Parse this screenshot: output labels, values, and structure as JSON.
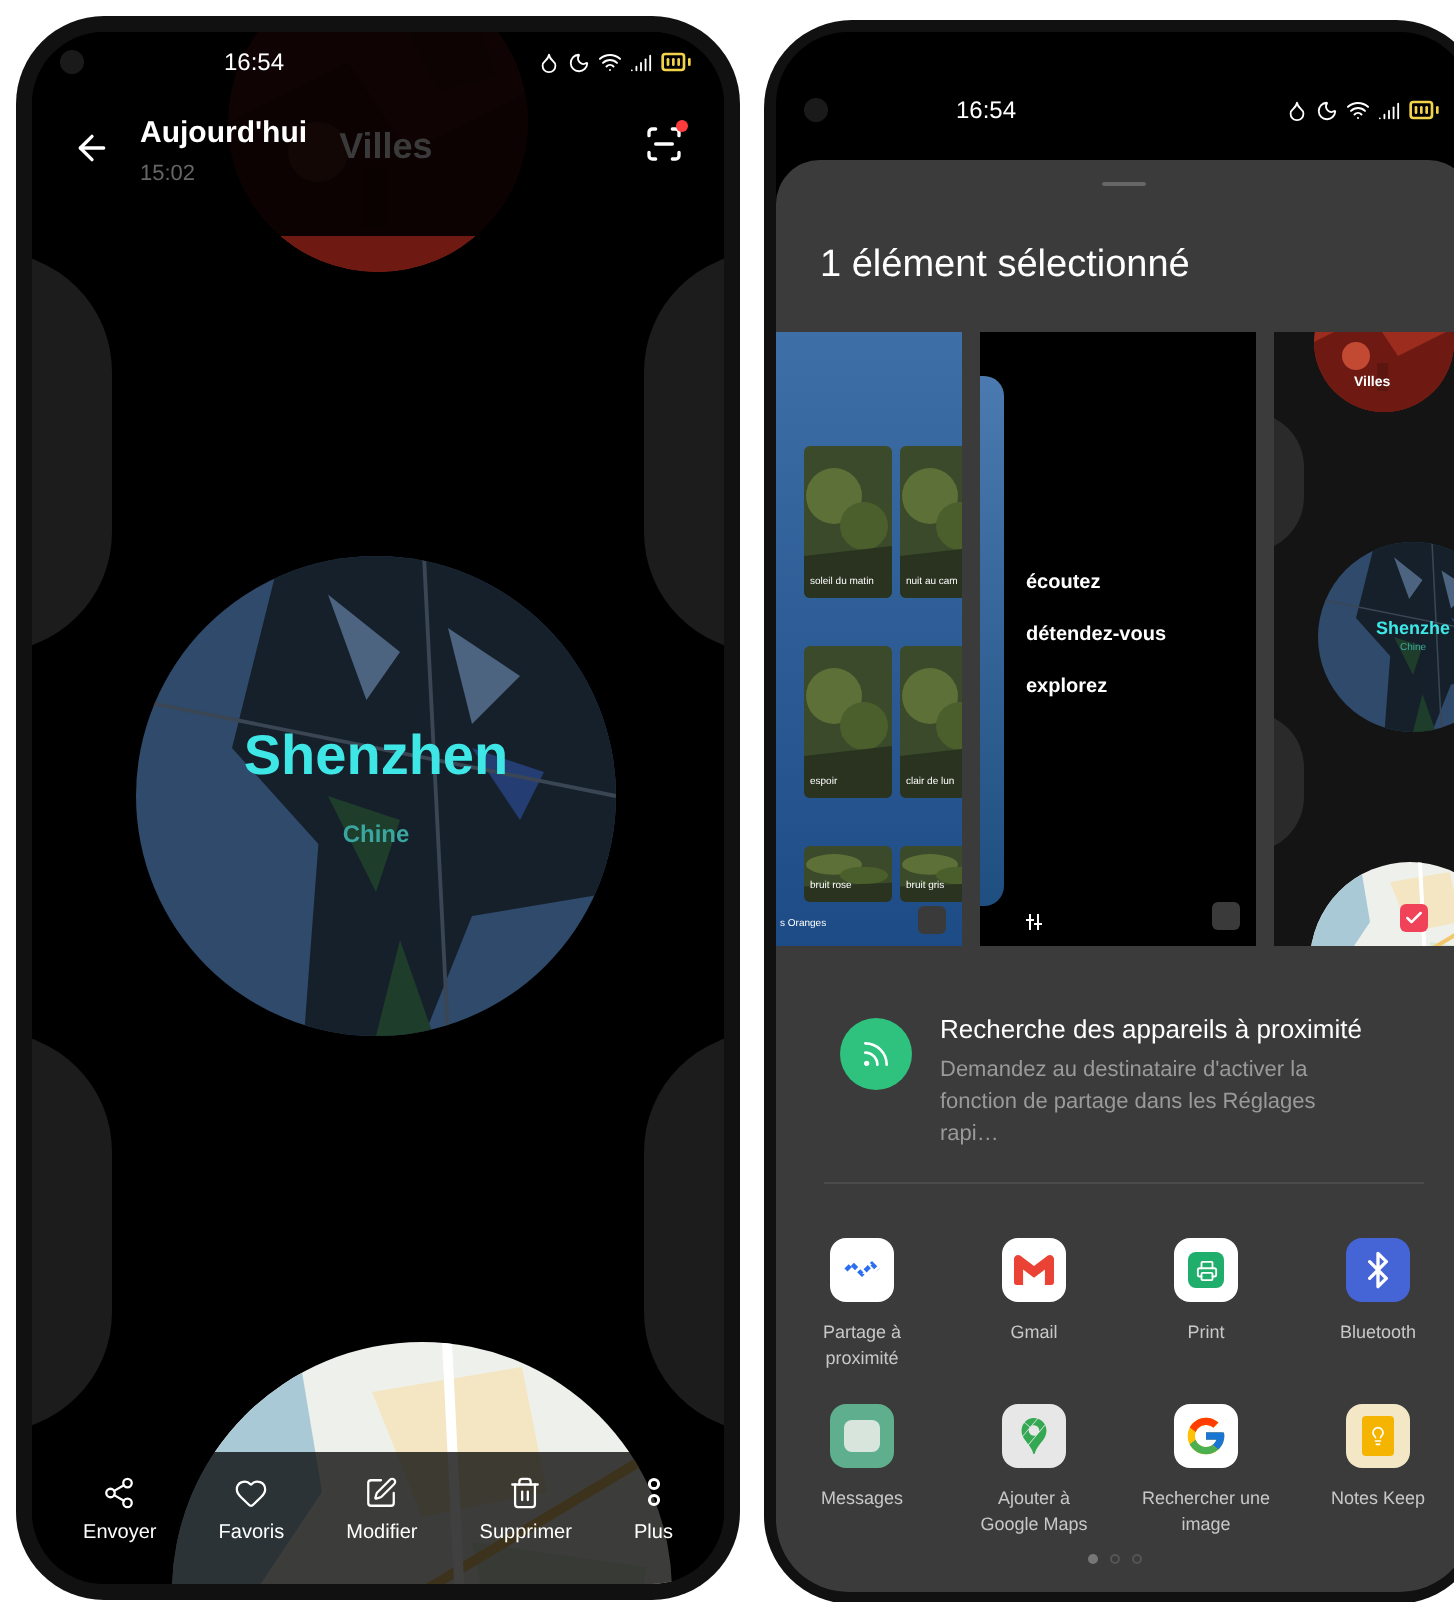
{
  "left_phone": {
    "status_bar": {
      "time": "16:54"
    },
    "header": {
      "title": "Aujourd'hui",
      "subtitle": "15:02",
      "background_title": "Villes"
    },
    "city_card": {
      "city": "Shenzhen",
      "country": "Chine"
    },
    "toolbar": [
      {
        "kind": "share",
        "label": "Envoyer"
      },
      {
        "kind": "heart",
        "label": "Favoris"
      },
      {
        "kind": "edit",
        "label": "Modifier"
      },
      {
        "kind": "trash",
        "label": "Supprimer"
      },
      {
        "kind": "more",
        "label": "Plus"
      }
    ]
  },
  "right_phone": {
    "status_bar": {
      "time": "16:54"
    },
    "share_sheet": {
      "title": "1 élément sélectionné",
      "previews": [
        {
          "kind": "wallpapers",
          "checked": false,
          "tiles": [
            "soleil du matin",
            "nuit au cam",
            "espoir",
            "clair de lun",
            "bruit rose",
            "bruit gris"
          ],
          "footer": "s Oranges"
        },
        {
          "kind": "text",
          "checked": false,
          "lines": [
            "écoutez",
            "détendez-vous",
            "explorez"
          ]
        },
        {
          "kind": "cities",
          "checked": true,
          "title": "Villes",
          "city": "Shenzhe",
          "country": "Chine"
        }
      ],
      "nearby": {
        "title": "Recherche des appareils à proximité",
        "description": "Demandez au destinataire d'activer la fonction de partage dans les Réglages rapi…"
      },
      "apps": [
        {
          "kind": "nearby",
          "label": "Partage à proximité"
        },
        {
          "kind": "gmail",
          "label": "Gmail"
        },
        {
          "kind": "print",
          "label": "Print"
        },
        {
          "kind": "bluetooth",
          "label": "Bluetooth"
        },
        {
          "kind": "messages",
          "label": "Messages"
        },
        {
          "kind": "maps",
          "label": "Ajouter à Google Maps"
        },
        {
          "kind": "google",
          "label": "Rechercher une image"
        },
        {
          "kind": "keep",
          "label": "Notes Keep"
        }
      ],
      "page_dots": [
        {
          "selected": true
        },
        {
          "selected": false
        },
        {
          "selected": false
        }
      ]
    }
  }
}
